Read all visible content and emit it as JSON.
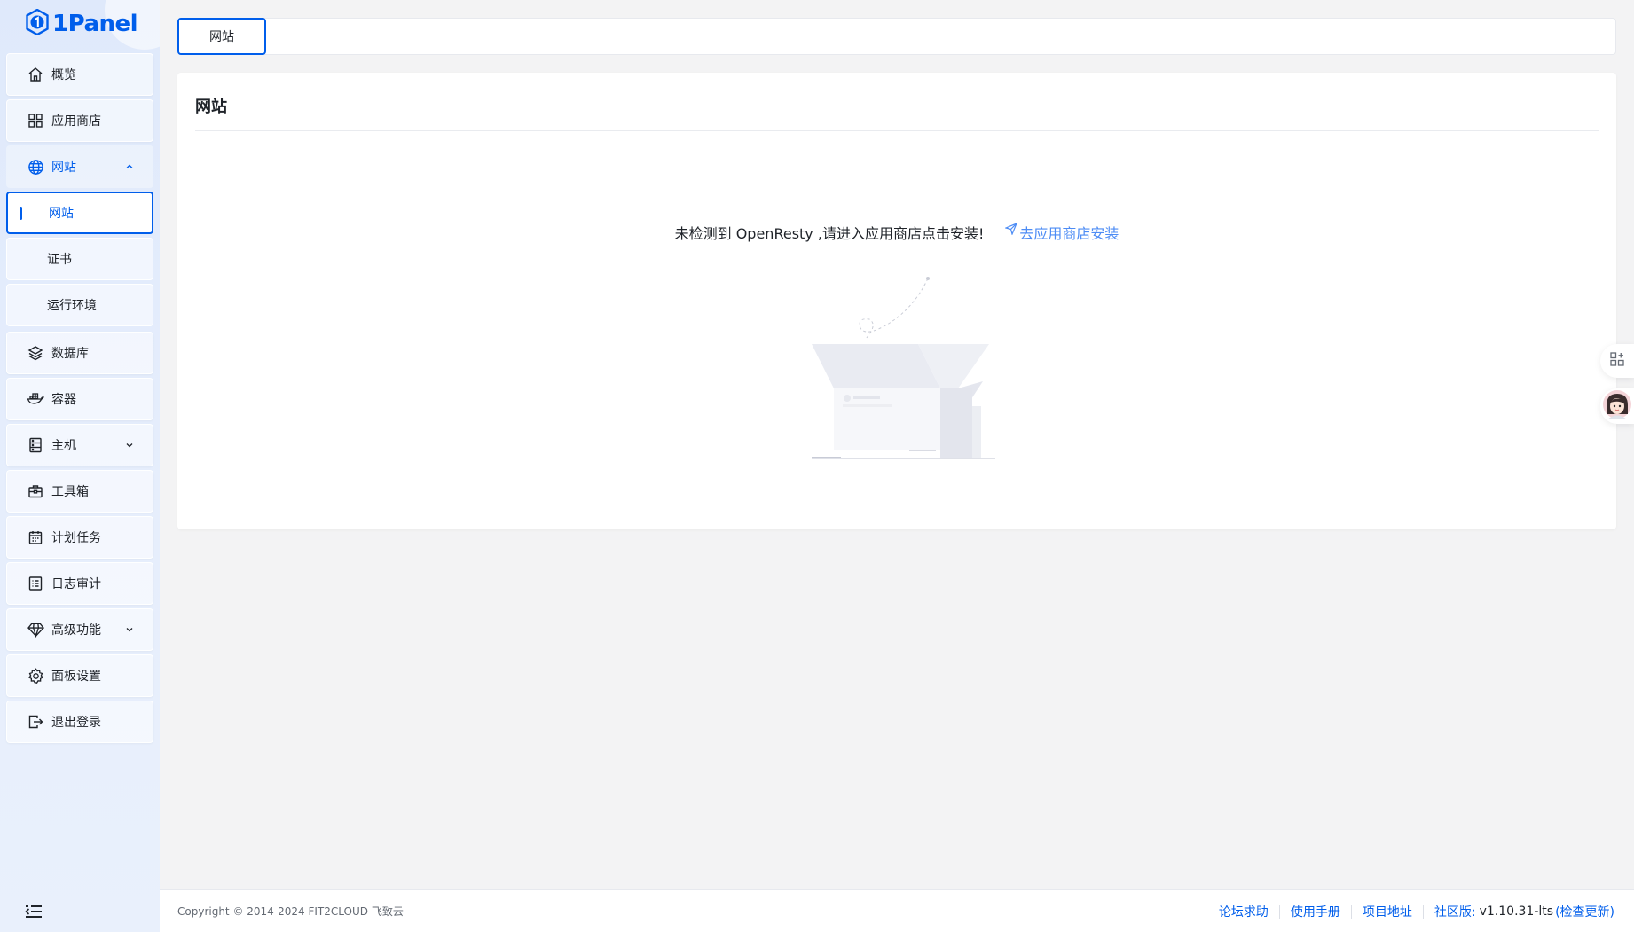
{
  "app": {
    "logo_text": "1Panel"
  },
  "sidebar": {
    "items": [
      {
        "label": "概览",
        "icon": "home-icon"
      },
      {
        "label": "应用商店",
        "icon": "grid-icon"
      },
      {
        "label": "网站",
        "icon": "globe-icon",
        "expanded": true,
        "children": [
          {
            "label": "网站",
            "active": true
          },
          {
            "label": "证书"
          },
          {
            "label": "运行环境"
          }
        ]
      },
      {
        "label": "数据库",
        "icon": "layers-icon"
      },
      {
        "label": "容器",
        "icon": "docker-icon"
      },
      {
        "label": "主机",
        "icon": "server-icon",
        "has_arrow": true
      },
      {
        "label": "工具箱",
        "icon": "toolbox-icon"
      },
      {
        "label": "计划任务",
        "icon": "calendar-icon"
      },
      {
        "label": "日志审计",
        "icon": "log-icon"
      },
      {
        "label": "高级功能",
        "icon": "diamond-icon",
        "has_arrow": true
      },
      {
        "label": "面板设置",
        "icon": "gear-icon"
      },
      {
        "label": "退出登录",
        "icon": "logout-icon"
      }
    ]
  },
  "tabs": {
    "active": "网站"
  },
  "card": {
    "title": "网站",
    "empty_message": "未检测到 OpenResty ,请进入应用商店点击安装!",
    "install_link": "去应用商店安装"
  },
  "footer": {
    "copyright": "Copyright © 2014-2024 FIT2CLOUD 飞致云",
    "links": [
      "论坛求助",
      "使用手册",
      "项目地址"
    ],
    "edition_label": "社区版:",
    "version": "v1.10.31-lts",
    "check_update": "(检查更新)"
  },
  "colors": {
    "accent": "#005eeb",
    "link": "#4d8cf5",
    "page_bg": "#f3f3f4",
    "sidebar_bg": "#e3ecfb"
  }
}
